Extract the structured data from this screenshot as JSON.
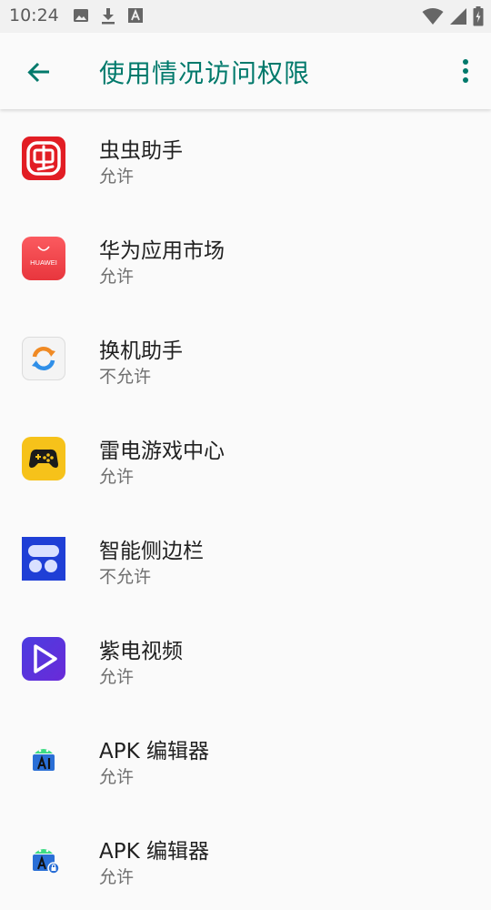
{
  "status_bar": {
    "time": "10:24",
    "left_icons": [
      "image-icon",
      "download-icon",
      "font-icon"
    ],
    "right_icons": [
      "wifi-icon",
      "signal-icon",
      "battery-charging-icon"
    ]
  },
  "app_bar": {
    "title": "使用情况访问权限",
    "accent_color": "#00796b"
  },
  "apps": [
    {
      "name": "虫虫助手",
      "status": "允许",
      "icon": "chongchong-icon"
    },
    {
      "name": "华为应用市场",
      "status": "允许",
      "icon": "huawei-appgallery-icon"
    },
    {
      "name": "换机助手",
      "status": "不允许",
      "icon": "phone-clone-icon"
    },
    {
      "name": "雷电游戏中心",
      "status": "允许",
      "icon": "gamepad-icon"
    },
    {
      "name": "智能侧边栏",
      "status": "不允许",
      "icon": "sidebar-icon"
    },
    {
      "name": "紫电视频",
      "status": "允许",
      "icon": "video-play-icon"
    },
    {
      "name": "APK 编辑器",
      "status": "允许",
      "icon": "apk-editor-icon"
    },
    {
      "name": "APK 编辑器",
      "status": "允许",
      "icon": "apk-editor-pro-icon"
    }
  ],
  "icon_text": {
    "huawei": "HUAWEI"
  }
}
